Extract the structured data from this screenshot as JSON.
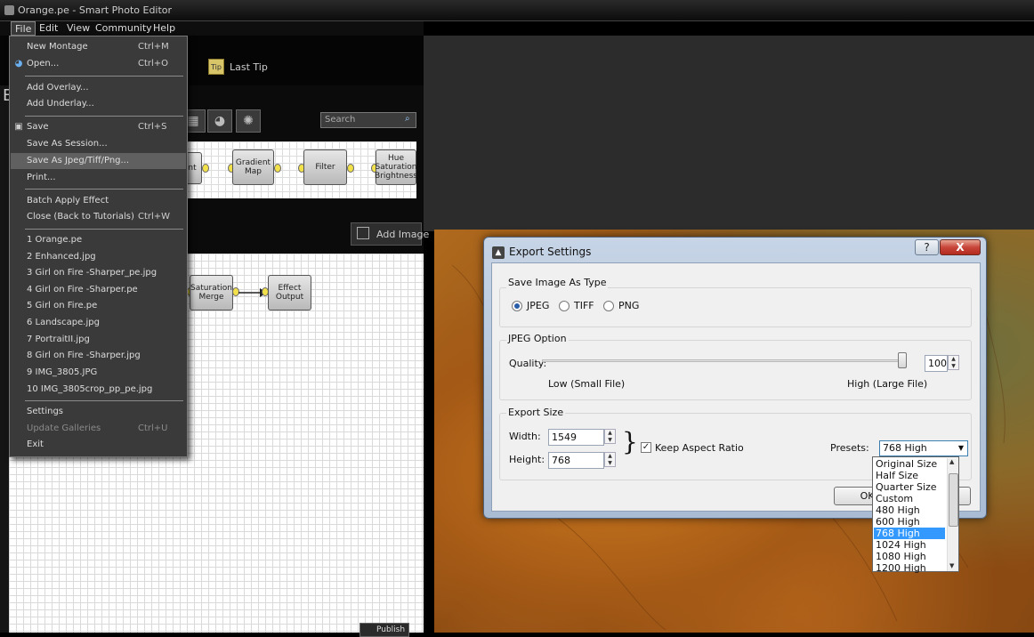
{
  "window": {
    "title": "Orange.pe - Smart Photo Editor"
  },
  "menubar": {
    "items": [
      "File",
      "Edit",
      "View",
      "Community",
      "Help"
    ]
  },
  "toolbar": {
    "last_tip": "Last Tip",
    "partial_label": "n",
    "left_letter": "E"
  },
  "effects": {
    "search_placeholder": "Search"
  },
  "strip_nodes": [
    "nt",
    "Gradient\nMap",
    "Filter",
    "Hue\nSaturation\nBrightness"
  ],
  "graph_nodes": [
    "Saturation\nMerge",
    "Effect\nOutput"
  ],
  "add_image": "Add Image",
  "publish": "Publish",
  "file_menu": {
    "items": [
      {
        "label": "New Montage",
        "shortcut": "Ctrl+M"
      },
      {
        "label": "Open...",
        "shortcut": "Ctrl+O"
      },
      {
        "label": "Add Overlay..."
      },
      {
        "label": "Add Underlay..."
      },
      {
        "label": "Save",
        "shortcut": "Ctrl+S"
      },
      {
        "label": "Save As Session..."
      },
      {
        "label": "Save As Jpeg/Tiff/Png..."
      },
      {
        "label": "Print..."
      },
      {
        "label": "Batch Apply Effect"
      },
      {
        "label": "Close (Back to Tutorials)",
        "shortcut": "Ctrl+W"
      },
      {
        "label": "1 Orange.pe"
      },
      {
        "label": "2 Enhanced.jpg"
      },
      {
        "label": "3 Girl on Fire -Sharper_pe.jpg"
      },
      {
        "label": "4 Girl on Fire -Sharper.pe"
      },
      {
        "label": "5 Girl on Fire.pe"
      },
      {
        "label": "6 Landscape.jpg"
      },
      {
        "label": "7 PortraitII.jpg"
      },
      {
        "label": "8 Girl on Fire -Sharper.jpg"
      },
      {
        "label": "9 IMG_3805.JPG"
      },
      {
        "label": "10 IMG_3805crop_pp_pe.jpg"
      },
      {
        "label": "Settings"
      },
      {
        "label": "Update Galleries",
        "shortcut": "Ctrl+U"
      },
      {
        "label": "Exit"
      }
    ]
  },
  "dialog": {
    "title": "Export Settings",
    "help": "?",
    "close": "X",
    "type_group": "Save Image As Type",
    "types": [
      "JPEG",
      "TIFF",
      "PNG"
    ],
    "selected_type": "JPEG",
    "jpeg_group": "JPEG Option",
    "quality_label": "Quality:",
    "quality_value": "100",
    "quality_fraction": 1.0,
    "low_label": "Low (Small File)",
    "high_label": "High (Large File)",
    "size_group": "Export Size",
    "width_label": "Width:",
    "width_value": "1549",
    "height_label": "Height:",
    "height_value": "768",
    "keep_aspect": "Keep Aspect Ratio",
    "keep_aspect_checked": true,
    "presets_label": "Presets:",
    "preset_selected": "768 High",
    "ok": "OK",
    "presets": [
      "Original Size",
      "Half Size",
      "Quarter Size",
      "Custom",
      "480 High",
      "600 High",
      "768 High",
      "1024 High",
      "1080 High",
      "1200 High"
    ]
  }
}
